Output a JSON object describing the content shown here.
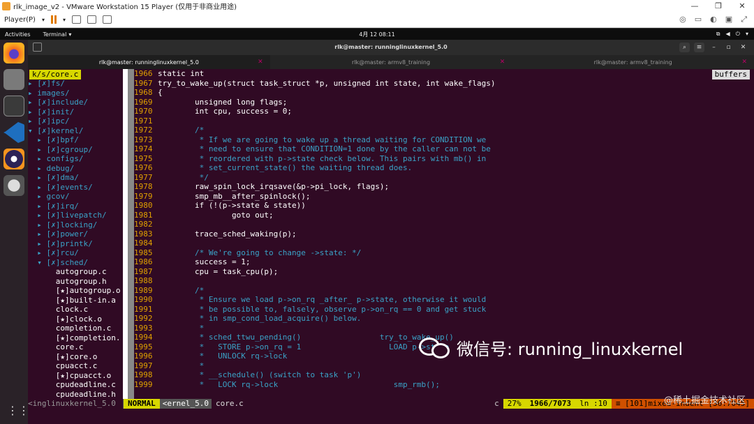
{
  "vmware": {
    "title": "rlk_image_v2 - VMware Workstation 15 Player (仅用于非商业用途)",
    "player_menu": "Player(P)",
    "controls": [
      "—",
      "❐",
      "✕"
    ]
  },
  "gnome": {
    "activities": "Activities",
    "terminal_menu": "Terminal",
    "clock": "4月 12 08:11",
    "sys_icons": [
      "network",
      "volume",
      "power"
    ]
  },
  "dock": {
    "items": [
      "firefox-icon",
      "files-icon",
      "terminal-icon",
      "vscode-icon",
      "eclipse-icon",
      "software-icon"
    ]
  },
  "terminal": {
    "title": "rlk@master: runninglinuxkernel_5.0",
    "tabs": [
      {
        "label": "rlk@master: runninglinuxkernel_5.0"
      },
      {
        "label": "rlk@master: armv8_training"
      },
      {
        "label": "rlk@master: armv8_training"
      }
    ]
  },
  "vim": {
    "tree_title": "k/s/core.c",
    "buffers_label": "buffers",
    "tree": [
      "▸ [✗]fs/",
      "▸ images/",
      "▸ [✗]include/",
      "▸ [✗]init/",
      "▸ [✗]ipc/",
      "▾ [✗]kernel/",
      "  ▸ [✗]bpf/",
      "  ▸ [✗]cgroup/",
      "  ▸ configs/",
      "  ▸ debug/",
      "  ▸ [✗]dma/",
      "  ▸ [✗]events/",
      "  ▸ gcov/",
      "  ▸ [✗]irq/",
      "  ▸ [✗]livepatch/",
      "  ▸ [✗]locking/",
      "  ▸ [✗]power/",
      "  ▸ [✗]printk/",
      "  ▸ [✗]rcu/",
      "  ▾ [✗]sched/",
      "      autogroup.c",
      "      autogroup.h",
      "      [★]autogroup.o",
      "      [★]built-in.a",
      "      clock.c",
      "      [★]clock.o",
      "      completion.c",
      "      [★]completion.",
      "      core.c",
      "      [★]core.o",
      "      cpuacct.c",
      "      [★]cpuacct.o",
      "      cpudeadline.c",
      "      cpudeadline.h"
    ],
    "code": [
      {
        "n": "1966",
        "t": "static int"
      },
      {
        "n": "1967",
        "t": "try_to_wake_up(struct task_struct *p, unsigned int state, int wake_flags)"
      },
      {
        "n": "1968",
        "t": "{"
      },
      {
        "n": "1969",
        "t": "        unsigned long flags;"
      },
      {
        "n": "1970",
        "t": "        int cpu, success = 0;"
      },
      {
        "n": "1971",
        "t": ""
      },
      {
        "n": "1972",
        "t": "        /*"
      },
      {
        "n": "1973",
        "t": "         * If we are going to wake up a thread waiting for CONDITION we"
      },
      {
        "n": "1974",
        "t": "         * need to ensure that CONDITION=1 done by the caller can not be"
      },
      {
        "n": "1975",
        "t": "         * reordered with p->state check below. This pairs with mb() in"
      },
      {
        "n": "1976",
        "t": "         * set_current_state() the waiting thread does."
      },
      {
        "n": "1977",
        "t": "         */"
      },
      {
        "n": "1978",
        "t": "        raw_spin_lock_irqsave(&p->pi_lock, flags);"
      },
      {
        "n": "1979",
        "t": "        smp_mb__after_spinlock();"
      },
      {
        "n": "1980",
        "t": "        if (!(p->state & state))"
      },
      {
        "n": "1981",
        "t": "                goto out;"
      },
      {
        "n": "1982",
        "t": ""
      },
      {
        "n": "1983",
        "t": "        trace_sched_waking(p);"
      },
      {
        "n": "1984",
        "t": ""
      },
      {
        "n": "1985",
        "t": "        /* We're going to change ->state: */"
      },
      {
        "n": "1986",
        "t": "        success = 1;"
      },
      {
        "n": "1987",
        "t": "        cpu = task_cpu(p);"
      },
      {
        "n": "1988",
        "t": ""
      },
      {
        "n": "1989",
        "t": "        /*"
      },
      {
        "n": "1990",
        "t": "         * Ensure we load p->on_rq _after_ p->state, otherwise it would"
      },
      {
        "n": "1991",
        "t": "         * be possible to, falsely, observe p->on_rq == 0 and get stuck"
      },
      {
        "n": "1992",
        "t": "         * in smp_cond_load_acquire() below."
      },
      {
        "n": "1993",
        "t": "         *"
      },
      {
        "n": "1994",
        "t": "         * sched_ttwu_pending()                 try_to_wake_up()"
      },
      {
        "n": "1995",
        "t": "         *   STORE p->on_rq = 1                   LOAD p->state"
      },
      {
        "n": "1996",
        "t": "         *   UNLOCK rq->lock"
      },
      {
        "n": "1997",
        "t": "         *"
      },
      {
        "n": "1998",
        "t": "         * __schedule() (switch to task 'p')"
      },
      {
        "n": "1999",
        "t": "         *   LOCK rq->lock                         smp_rmb();"
      }
    ],
    "status": {
      "left": "<inglinuxkernel_5.0",
      "mode": "NORMAL",
      "path": "<ernel_5.0",
      "file": "core.c",
      "filetype": "c",
      "percent": "27%",
      "lines": "1966/7073",
      "col": "ln :10",
      "warn": "≡ [101]mixed-indent [36:7045]"
    }
  },
  "watermark": {
    "text": "微信号: running_linuxkernel",
    "sub": "@稀土掘金技术社区"
  }
}
